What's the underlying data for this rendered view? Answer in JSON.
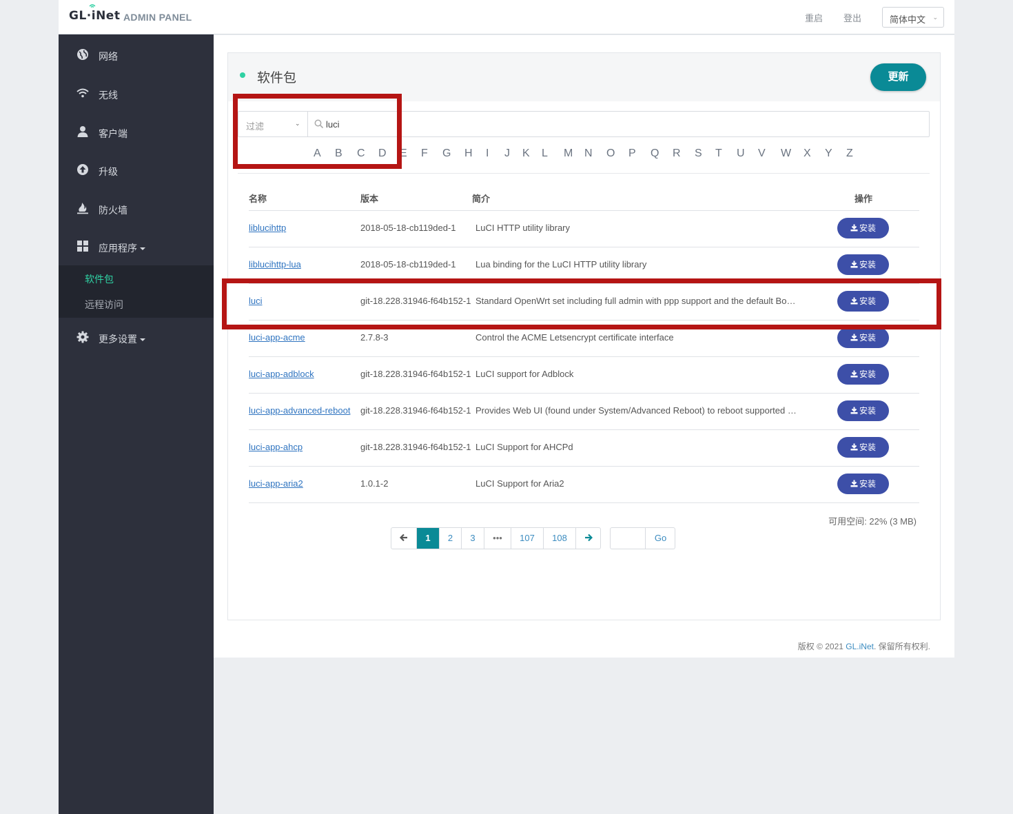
{
  "header": {
    "logo_text": "GL·iNet",
    "panel_title": "ADMIN PANEL",
    "reboot_label": "重启",
    "logout_label": "登出",
    "language": "简体中文"
  },
  "sidebar": {
    "items": [
      {
        "label": "网络",
        "icon": "globe-icon"
      },
      {
        "label": "无线",
        "icon": "wifi-icon"
      },
      {
        "label": "客户端",
        "icon": "user-icon"
      },
      {
        "label": "升级",
        "icon": "upload-icon"
      },
      {
        "label": "防火墙",
        "icon": "fire-icon"
      },
      {
        "label": "应用程序",
        "icon": "grid-icon"
      },
      {
        "label": "更多设置",
        "icon": "gear-icon"
      }
    ],
    "submenu": [
      {
        "label": "软件包",
        "active": true
      },
      {
        "label": "远程访问",
        "active": false
      }
    ],
    "active_color": "#2fd1a3"
  },
  "card": {
    "title": "软件包",
    "update_label": "更新"
  },
  "filter": {
    "select_label": "过滤",
    "search_value": "luci"
  },
  "alphabet": [
    "A",
    "B",
    "C",
    "D",
    "E",
    "F",
    "G",
    "H",
    "I",
    "J",
    "K",
    "L",
    "M",
    "N",
    "O",
    "P",
    "Q",
    "R",
    "S",
    "T",
    "U",
    "V",
    "W",
    "X",
    "Y",
    "Z"
  ],
  "table": {
    "headers": {
      "name": "名称",
      "version": "版本",
      "desc": "简介",
      "action": "操作"
    },
    "install_label": "安装",
    "rows": [
      {
        "name": "liblucihttp",
        "version": "2018-05-18-cb119ded-1",
        "desc": "LuCI HTTP utility library"
      },
      {
        "name": "liblucihttp-lua",
        "version": "2018-05-18-cb119ded-1",
        "desc": "Lua binding for the LuCI HTTP utility library"
      },
      {
        "name": "luci",
        "version": "git-18.228.31946-f64b152-1",
        "desc": "Standard OpenWrt set including full admin with ppp support and the default Bootstrap theme"
      },
      {
        "name": "luci-app-acme",
        "version": "2.7.8-3",
        "desc": "Control the ACME Letsencrypt certificate interface"
      },
      {
        "name": "luci-app-adblock",
        "version": "git-18.228.31946-f64b152-1",
        "desc": "LuCI support for Adblock"
      },
      {
        "name": "luci-app-advanced-reboot",
        "version": "git-18.228.31946-f64b152-1",
        "desc": "Provides Web UI (found under System/Advanced Reboot) to reboot supported devices"
      },
      {
        "name": "luci-app-ahcp",
        "version": "git-18.228.31946-f64b152-1",
        "desc": "LuCI Support for AHCPd"
      },
      {
        "name": "luci-app-aria2",
        "version": "1.0.1-2",
        "desc": "LuCI Support for Aria2"
      }
    ]
  },
  "space_info": "可用空间: 22% (3 MB)",
  "pagination": {
    "pages": [
      "1",
      "2",
      "3",
      "•••",
      "107",
      "108"
    ],
    "current": "1",
    "go_label": "Go"
  },
  "footer": {
    "prefix": "版权 © 2021 ",
    "brand": "GL.iNet",
    "suffix": ". 保留所有权利."
  }
}
